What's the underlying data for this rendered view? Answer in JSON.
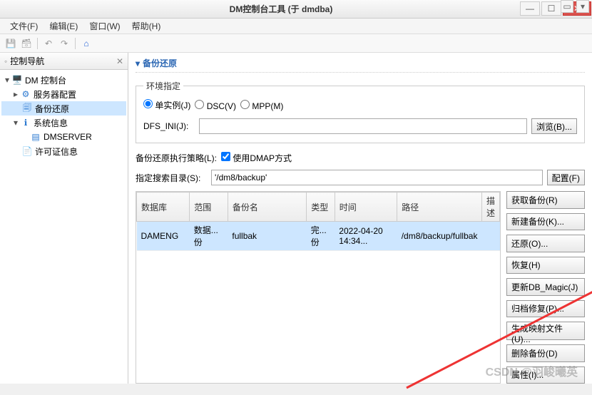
{
  "window": {
    "title": "DM控制台工具 (于 dmdba)"
  },
  "menu": {
    "file": "文件(F)",
    "edit": "编辑(E)",
    "window": "窗口(W)",
    "help": "帮助(H)"
  },
  "sidebar": {
    "tab": "控制导航",
    "root": "DM 控制台",
    "serverCfg": "服务器配置",
    "backupRestore": "备份还原",
    "sysInfo": "系统信息",
    "dmserver": "DMSERVER",
    "license": "许可证信息"
  },
  "content": {
    "title": "备份还原",
    "envLegend": "环境指定",
    "radios": {
      "single": "单实例(J)",
      "dsc": "DSC(V)",
      "mpp": "MPP(M)"
    },
    "dfsLabel": "DFS_INI(J):",
    "browse": "浏览(B)...",
    "policyLabel": "备份还原执行策略(L):",
    "dmapLabel": "使用DMAP方式",
    "searchDirLabel": "指定搜索目录(S):",
    "searchDirValue": "'/dm8/backup'",
    "configure": "配置(F)"
  },
  "table": {
    "cols": {
      "db": "数据库",
      "range": "范围",
      "name": "备份名",
      "type": "类型",
      "time": "时间",
      "path": "路径",
      "desc": "描述"
    },
    "rows": [
      {
        "db": "DAMENG",
        "range": "数据...份",
        "name": "fullbak",
        "type": "完...份",
        "time": "2022-04-20 14:34...",
        "path": "/dm8/backup/fullbak",
        "desc": ""
      }
    ]
  },
  "buttons": {
    "fetch": "获取备份(R)",
    "new": "新建备份(K)...",
    "restore": "还原(O)...",
    "recover": "恢复(H)",
    "magic": "更新DB_Magic(J)",
    "archive": "归档修复(P)...",
    "mapfile": "生成映射文件(U)...",
    "delete": "删除备份(D)",
    "props": "属性(I)..."
  },
  "watermark": "CSDN @羽峻曦英"
}
